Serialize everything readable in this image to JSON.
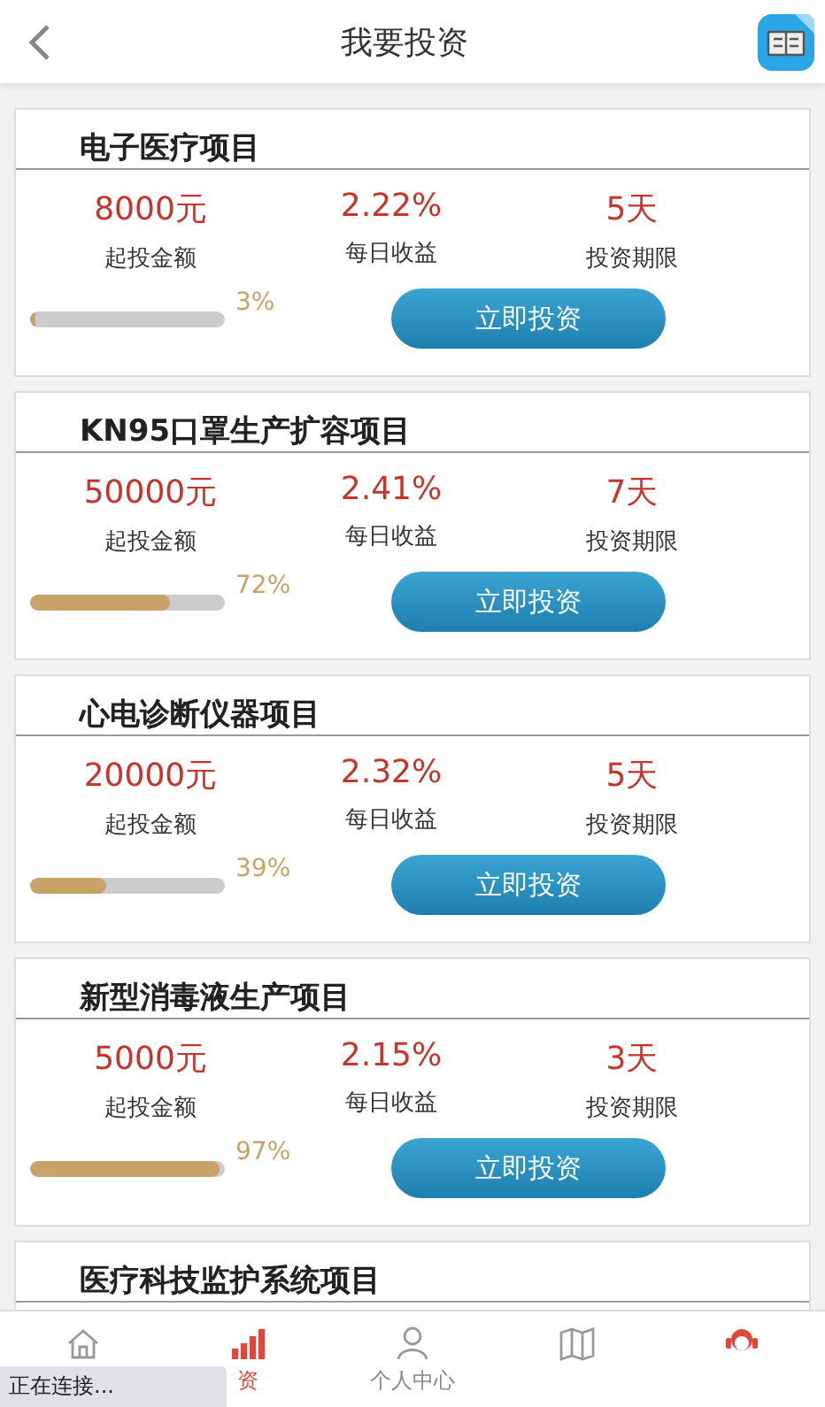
{
  "header": {
    "title": "我要投资"
  },
  "projects": [
    {
      "title": "电子医疗项目",
      "amount": "8000元",
      "amount_label": "起投金额",
      "rate": "2.22%",
      "rate_label": "每日收益",
      "term": "5天",
      "term_label": "投资期限",
      "level": 0.03,
      "percent": "3%",
      "button": "立即投资"
    },
    {
      "title": "KN95口罩生产扩容项目",
      "amount": "50000元",
      "amount_label": "起投金额",
      "rate": "2.41%",
      "rate_label": "每日收益",
      "term": "7天",
      "term_label": "投资期限",
      "level": 0.72,
      "percent": "72%",
      "button": "立即投资"
    },
    {
      "title": "心电诊断仪器项目",
      "amount": "20000元",
      "amount_label": "起投金额",
      "rate": "2.32%",
      "rate_label": "每日收益",
      "term": "5天",
      "term_label": "投资期限",
      "level": 0.39,
      "percent": "39%",
      "button": "立即投资"
    },
    {
      "title": "新型消毒液生产项目",
      "amount": "5000元",
      "amount_label": "起投金额",
      "rate": "2.15%",
      "rate_label": "每日收益",
      "term": "3天",
      "term_label": "投资期限",
      "level": 0.97,
      "percent": "97%",
      "button": "立即投资"
    },
    {
      "title": "医疗科技监护系统项目"
    }
  ],
  "nav": [
    {
      "kind": "home",
      "selected": false
    },
    {
      "kind": "chart",
      "label": "资",
      "selected": true
    },
    {
      "kind": "person",
      "label": "个人中心",
      "selected": false
    },
    {
      "kind": "map",
      "selected": false
    },
    {
      "kind": "service",
      "selected": false
    }
  ],
  "status": "正在连接..."
}
